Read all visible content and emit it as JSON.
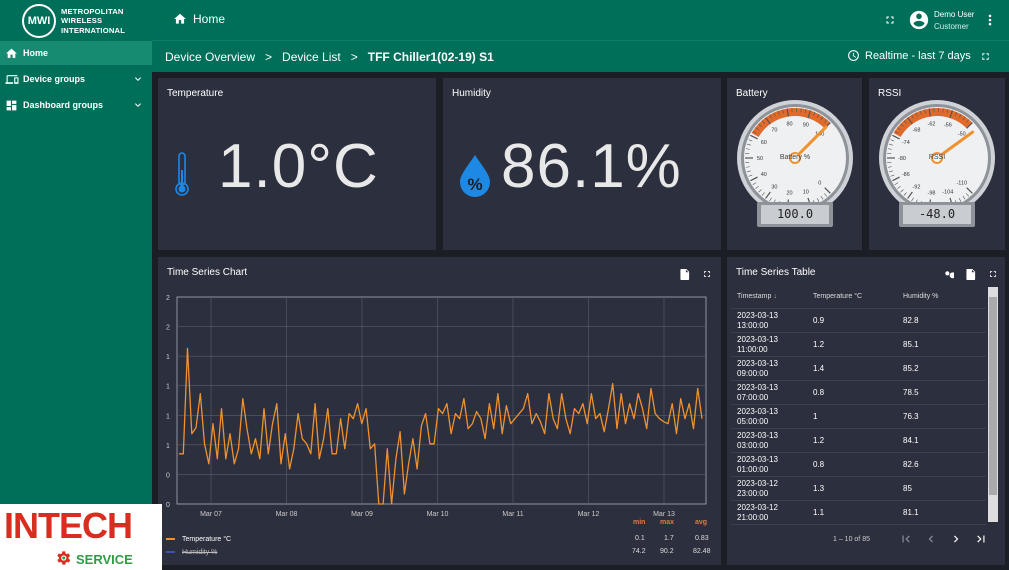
{
  "logo": {
    "badge": "MWI",
    "line1": "METROPOLITAN",
    "line2": "WIRELESS",
    "line3": "INTERNATIONAL"
  },
  "sidebar": {
    "items": [
      {
        "label": "Home",
        "icon": "home-icon"
      },
      {
        "label": "Device groups",
        "icon": "devices-icon"
      },
      {
        "label": "Dashboard groups",
        "icon": "dashboard-icon"
      }
    ]
  },
  "topbar": {
    "title": "Home",
    "user_name": "Demo User",
    "user_role": "Customer"
  },
  "breadcrumb": {
    "items": [
      "Device Overview",
      "Device List",
      "TFF Chiller1(02-19) S1"
    ],
    "separator": ">"
  },
  "timewindow": "Realtime - last 7 days",
  "cards": {
    "temperature": {
      "title": "Temperature",
      "value": "1.0°C"
    },
    "humidity": {
      "title": "Humidity",
      "value": "86.1%",
      "icon_glyph": "%"
    },
    "battery": {
      "title": "Battery",
      "gauge_label": "Battery %",
      "value": "100.0",
      "ticks": [
        "0",
        "10",
        "20",
        "30",
        "40",
        "50",
        "60",
        "70",
        "80",
        "90",
        "100"
      ],
      "percent": 100
    },
    "rssi": {
      "title": "RSSI",
      "gauge_label": "RSSI",
      "value": "-48.0",
      "ticks": [
        "-110",
        "-104",
        "-98",
        "-92",
        "-86",
        "-80",
        "-74",
        "-68",
        "-62",
        "-56",
        "-50"
      ],
      "value_num": -48
    }
  },
  "chart": {
    "title": "Time Series Chart"
  },
  "chart_data": {
    "type": "line",
    "yticks": [
      "2",
      "2",
      "1",
      "1",
      "1",
      "1",
      "0",
      "0"
    ],
    "ylim": [
      0,
      2
    ],
    "xticks": [
      "Mar 07",
      "Mar 08",
      "Mar 09",
      "Mar 10",
      "Mar 11",
      "Mar 12",
      "Mar 13"
    ],
    "series": [
      {
        "name": "Temperature °C",
        "color": "#f0912f",
        "values": [
          0.5,
          0.5,
          1.55,
          0.7,
          0.76,
          1.1,
          0.6,
          0.4,
          0.8,
          0.45,
          0.95,
          0.45,
          0.7,
          0.4,
          0.55,
          1.05,
          0.75,
          0.5,
          0.65,
          0.45,
          0.95,
          0.5,
          0.8,
          1.0,
          0.4,
          0.7,
          0.35,
          0.55,
          0.9,
          0.65,
          0.6,
          0.5,
          1.0,
          0.45,
          0.65,
          0.95,
          0.5,
          0.5,
          0.85,
          0.55,
          0.9,
          0.85,
          1.0,
          0.8,
          0.95,
          0.55,
          0.6,
          0.0,
          0.0,
          0.55,
          0.0,
          0.45,
          0.72,
          0.1,
          0.4,
          0.65,
          0.35,
          0.78,
          0.9,
          0.6,
          0.6,
          0.95,
          0.9,
          1.0,
          0.7,
          0.9,
          0.85,
          1.05,
          0.75,
          0.8,
          0.92,
          0.85,
          0.65,
          1.0,
          0.75,
          1.1,
          0.7,
          0.98,
          0.8,
          0.85,
          0.9,
          0.95,
          1.1,
          0.8,
          0.9,
          0.82,
          0.7,
          1.1,
          0.85,
          0.75,
          1.1,
          0.85,
          0.7,
          0.95,
          0.9,
          1.0,
          0.8,
          1.1,
          0.85,
          0.9,
          0.72,
          0.95,
          1.2,
          0.75,
          1.1,
          0.8,
          1.0,
          0.85,
          1.1,
          0.95,
          0.75,
          1.15,
          0.9,
          0.85,
          0.82,
          0.8,
          1.0,
          0.7,
          1.05,
          0.85,
          1.0,
          0.75,
          1.15,
          0.85
        ]
      },
      {
        "name": "Humidity %",
        "color": "#3f51b5",
        "values": []
      }
    ],
    "legend": {
      "headers": [
        "min",
        "max",
        "avg"
      ],
      "rows": [
        {
          "name": "Temperature °C",
          "min": "0.1",
          "max": "1.7",
          "avg": "0.83"
        },
        {
          "name": "Humidity %",
          "min": "74.2",
          "max": "90.2",
          "avg": "82.48"
        }
      ]
    }
  },
  "table": {
    "title": "Time Series Table",
    "headers": [
      "Timestamp",
      "Temperature °C",
      "Humidity %"
    ],
    "rows": [
      [
        "2023-03-13",
        "13:00:00",
        "0.9",
        "82.8"
      ],
      [
        "2023-03-13",
        "11:00:00",
        "1.2",
        "85.1"
      ],
      [
        "2023-03-13",
        "09:00:00",
        "1.4",
        "85.2"
      ],
      [
        "2023-03-13",
        "07:00:00",
        "0.8",
        "78.5"
      ],
      [
        "2023-03-13",
        "05:00:00",
        "1",
        "76.3"
      ],
      [
        "2023-03-13",
        "03:00:00",
        "1.2",
        "84.1"
      ],
      [
        "2023-03-13",
        "01:00:00",
        "0.8",
        "82.6"
      ],
      [
        "2023-03-12",
        "23:00:00",
        "1.3",
        "85"
      ],
      [
        "2023-03-12",
        "21:00:00",
        "1.1",
        "81.1"
      ]
    ],
    "pager": "1 – 10 of 85"
  },
  "watermark": {
    "text1": "INTECH",
    "text2": "SERVICE"
  },
  "colors": {
    "header": "#006f5a",
    "card": "#2c2f3d",
    "accent": "#f0912f",
    "gauge_arc": "#e06a2a"
  }
}
